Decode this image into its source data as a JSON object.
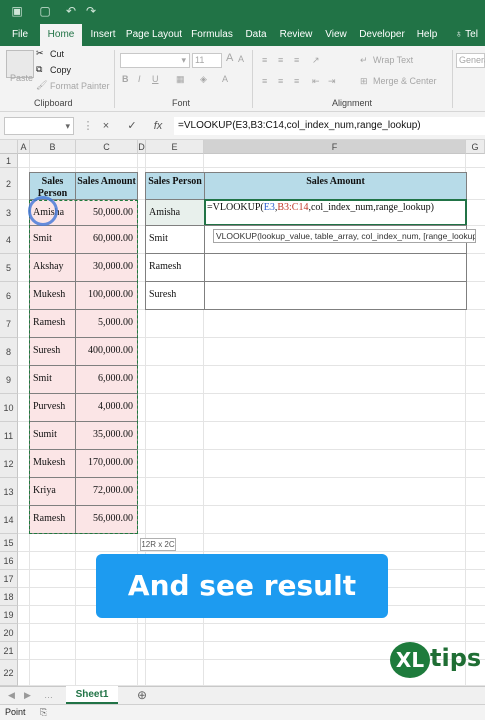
{
  "ribbon_tabs": [
    "File",
    "Home",
    "Insert",
    "Page Layout",
    "Formulas",
    "Data",
    "Review",
    "View",
    "Developer",
    "Help",
    "Tel"
  ],
  "active_tab": "Home",
  "clipboard": {
    "cut": "Cut",
    "copy": "Copy",
    "format_painter": "Format Painter",
    "paste": "Paste",
    "label": "Clipboard"
  },
  "font": {
    "size": "11",
    "label": "Font"
  },
  "alignment": {
    "wrap": "Wrap Text",
    "merge": "Merge & Center",
    "label": "Alignment"
  },
  "number": {
    "format": "General"
  },
  "formula_bar": {
    "cancel": "×",
    "enter": "✓",
    "fx": "fx",
    "formula": "=VLOOKUP(E3,B3:C14,col_index_num,range_lookup)"
  },
  "columns": [
    "A",
    "B",
    "C",
    "D",
    "E",
    "F",
    "G"
  ],
  "rows": [
    "1",
    "2",
    "3",
    "4",
    "5",
    "6",
    "7",
    "8",
    "9",
    "10",
    "11",
    "12",
    "13",
    "14",
    "15",
    "16",
    "17",
    "18",
    "19",
    "20",
    "21",
    "22"
  ],
  "table1": {
    "header_person": "Sales Person",
    "header_amount": "Sales Amount",
    "rows": [
      {
        "name": "Amisha",
        "amount": "50,000.00"
      },
      {
        "name": "Smit",
        "amount": "60,000.00"
      },
      {
        "name": "Akshay",
        "amount": "30,000.00"
      },
      {
        "name": "Mukesh",
        "amount": "100,000.00"
      },
      {
        "name": "Ramesh",
        "amount": "5,000.00"
      },
      {
        "name": "Suresh",
        "amount": "400,000.00"
      },
      {
        "name": "Smit",
        "amount": "6,000.00"
      },
      {
        "name": "Purvesh",
        "amount": "4,000.00"
      },
      {
        "name": "Sumit",
        "amount": "35,000.00"
      },
      {
        "name": "Mukesh",
        "amount": "170,000.00"
      },
      {
        "name": "Kriya",
        "amount": "72,000.00"
      },
      {
        "name": "Ramesh",
        "amount": "56,000.00"
      }
    ]
  },
  "table2": {
    "header_person": "Sales Person",
    "header_amount": "Sales Amount",
    "names": [
      "Amisha",
      "Smit",
      "Ramesh",
      "Suresh"
    ],
    "editing_formula_prefix": "=VLOOKUP(",
    "editing_ref1": "E3",
    "editing_comma": ",",
    "editing_ref2": "B3:C14",
    "editing_rest": ",col_index_num,range_lookup)"
  },
  "tooltip": "VLOOKUP(lookup_value, table_array, col_index_num, [range_lookup])",
  "selection_size": "12R x 2C",
  "banner": "And see result",
  "logo": {
    "xl": "XL",
    "tips": "tips"
  },
  "sheet_tab": "Sheet1",
  "status": "Point",
  "colors": {
    "excel_green": "#217346",
    "header_blue": "#b7dbe8",
    "pink_fill": "#fbe5e6",
    "banner_blue": "#1d9bf0"
  }
}
